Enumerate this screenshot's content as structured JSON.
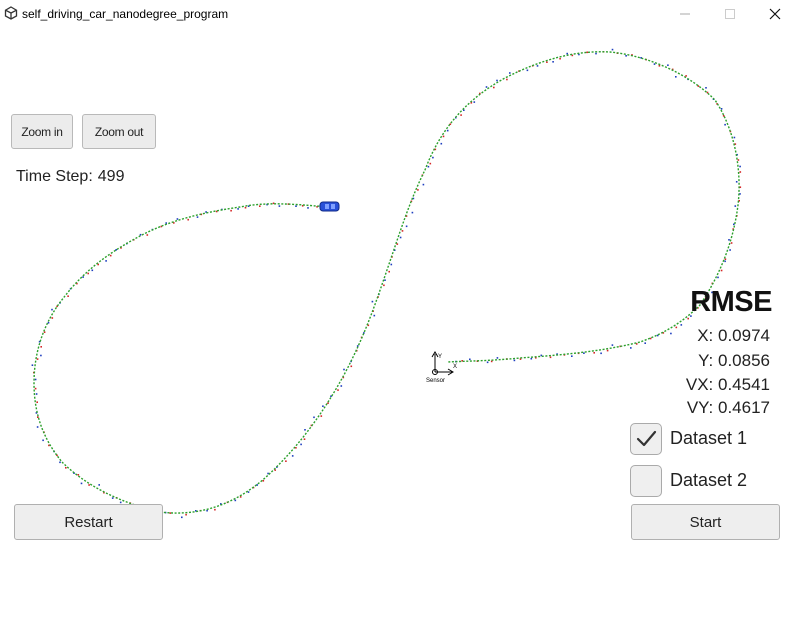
{
  "window": {
    "title": "self_driving_car_nanodegree_program",
    "icons": [
      "unity-icon",
      "minimize-icon",
      "maximize-icon",
      "close-icon"
    ]
  },
  "toolbar": {
    "zoom_in_label": "Zoom in",
    "zoom_out_label": "Zoom out"
  },
  "status": {
    "time_step_label": "Time Step:",
    "time_step_value": "499"
  },
  "sensor": {
    "label": "Sensor",
    "axis_y_label": "Y",
    "axis_x_label": "X"
  },
  "rmse": {
    "title": "RMSE",
    "x": "X: 0.0974",
    "y": "Y: 0.0856",
    "vx": "VX: 0.4541",
    "vy": "VY: 0.4617"
  },
  "datasets": [
    {
      "label": "Dataset 1",
      "checked": true
    },
    {
      "label": "Dataset 2",
      "checked": false
    }
  ],
  "controls": {
    "restart_label": "Restart",
    "start_label": "Start"
  },
  "colors": {
    "estimate": "#2ca02c",
    "lidar": "#d62728",
    "radar": "#1f3fbf",
    "car": "#2850d8"
  }
}
